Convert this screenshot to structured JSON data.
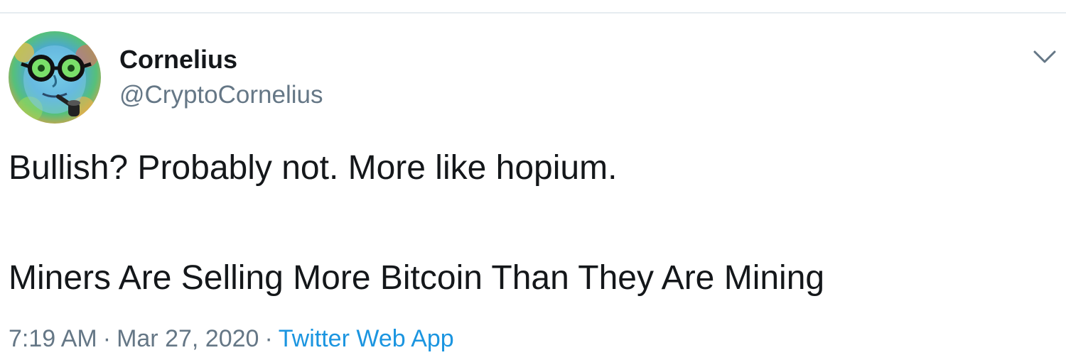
{
  "tweet": {
    "display_name": "Cornelius",
    "handle": "@CryptoCornelius",
    "text_line_1": "Bullish? Probably not. More like hopium.",
    "text_line_2": "Miners Are Selling More Bitcoin Than They Are Mining",
    "time": "7:19 AM",
    "separator": "·",
    "date": "Mar 27, 2020",
    "source": "Twitter Web App",
    "avatar_icon": "avatar-glasses-pipe-icon",
    "menu_icon": "chevron-down-icon"
  },
  "colors": {
    "text_primary": "#14171a",
    "text_secondary": "#657786",
    "link": "#1b95e0",
    "divider": "#e6ecf0"
  }
}
